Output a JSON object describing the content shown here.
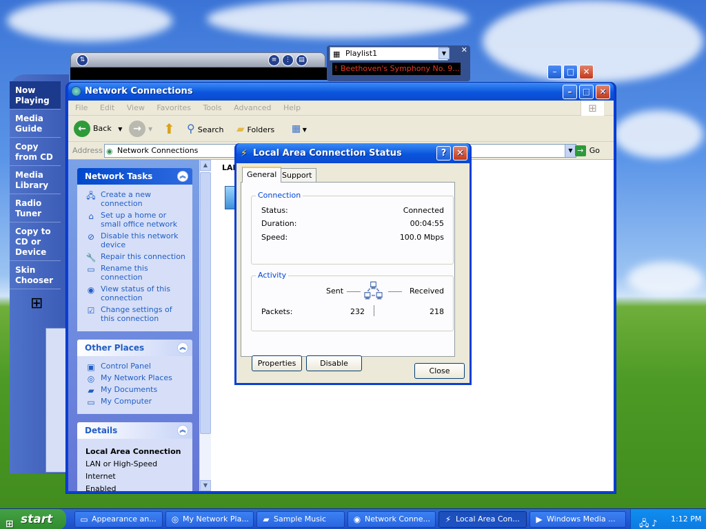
{
  "colors": {
    "xp_blue": "#0a3fd6",
    "task_pane": "#6375d6",
    "link": "#215dc6",
    "dialog_face": "#ece9d8",
    "group_label": "#0046d5",
    "start_green": "#2f8d2f",
    "track_red": "#e43a1d"
  },
  "media_player": {
    "nav_items": [
      "Now Playing",
      "Media Guide",
      "Copy from CD",
      "Media Library",
      "Radio Tuner",
      "Copy to CD or Device",
      "Skin Chooser"
    ],
    "selected_item": "Now Playing",
    "playlist_select": "Playlist1",
    "now_playing_track": "Beethoven's Symphony No. 9..."
  },
  "explorer": {
    "title": "Network Connections",
    "menu": [
      "File",
      "Edit",
      "View",
      "Favorites",
      "Tools",
      "Advanced",
      "Help"
    ],
    "toolbar": {
      "back": "Back",
      "search": "Search",
      "folders": "Folders"
    },
    "address_label": "Address",
    "address_value": "Network Connections",
    "go_label": "Go",
    "network_tasks": {
      "header": "Network Tasks",
      "items": [
        {
          "label": "Create a new connection",
          "icon": "new-connection-icon"
        },
        {
          "label": "Set up a home or small office network",
          "icon": "home-network-icon"
        },
        {
          "label": "Disable this network device",
          "icon": "disable-device-icon"
        },
        {
          "label": "Repair this connection",
          "icon": "repair-icon"
        },
        {
          "label": "Rename this connection",
          "icon": "rename-icon"
        },
        {
          "label": "View status of this connection",
          "icon": "status-icon"
        },
        {
          "label": "Change settings of this connection",
          "icon": "settings-icon"
        }
      ]
    },
    "other_places": {
      "header": "Other Places",
      "items": [
        "Control Panel",
        "My Network Places",
        "My Documents",
        "My Computer"
      ]
    },
    "details": {
      "header": "Details",
      "title": "Local Area Connection",
      "line1": "LAN or High-Speed Internet",
      "line2": "Enabled"
    },
    "list_label": "LAN"
  },
  "dialog": {
    "title": "Local Area Connection Status",
    "tabs": [
      "General",
      "Support"
    ],
    "active_tab": "General",
    "connection": {
      "label": "Connection",
      "status_label": "Status:",
      "status_value": "Connected",
      "duration_label": "Duration:",
      "duration_value": "00:04:55",
      "speed_label": "Speed:",
      "speed_value": "100.0 Mbps"
    },
    "activity": {
      "label": "Activity",
      "sent_label": "Sent",
      "received_label": "Received",
      "packets_label": "Packets:",
      "packets_sent": "232",
      "packets_received": "218"
    },
    "properties_button": "Properties",
    "disable_button": "Disable",
    "close_button": "Close"
  },
  "taskbar": {
    "start_label": "start",
    "tasks": [
      {
        "label": "Appearance an...",
        "icon": "display-icon"
      },
      {
        "label": "My Network Pla...",
        "icon": "network-places-icon"
      },
      {
        "label": "Sample Music",
        "icon": "folder-icon"
      },
      {
        "label": "Network Conne...",
        "icon": "network-connections-icon"
      },
      {
        "label": "Local Area Con...",
        "icon": "lan-icon"
      },
      {
        "label": "Windows Media ...",
        "icon": "media-player-icon"
      }
    ],
    "active_task": "Local Area Con...",
    "clock": "1:12 PM"
  }
}
